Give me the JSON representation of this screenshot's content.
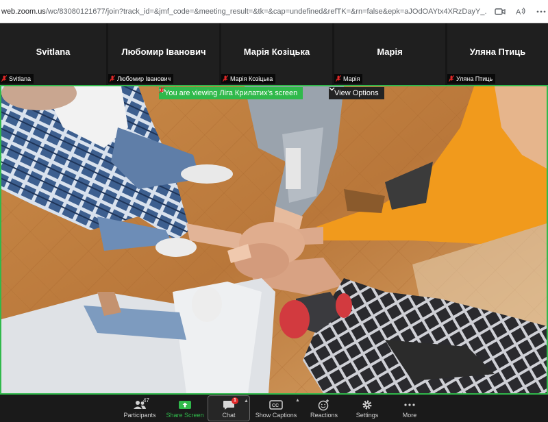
{
  "browser": {
    "url_host": "web.zoom.us",
    "url_path": "/wc/83080121677/join?track_id=&jmf_code=&meeting_result=&tk=&cap=undefined&refTK=&rn=false&epk=aJOdOAYtx4XRzDayY_..."
  },
  "participants": [
    {
      "name": "Svitlana",
      "label": "Svitlana"
    },
    {
      "name": "Любомир Іванович",
      "label": "Любомир Іванович"
    },
    {
      "name": "Марія Козіцька",
      "label": "Марія Козіцька"
    },
    {
      "name": "Марія",
      "label": "Марія"
    },
    {
      "name": "Уляна Птиць",
      "label": "Уляна Птиць"
    }
  ],
  "share": {
    "viewing_text": "You are viewing Ліга Крилатих's screen",
    "view_options": "View Options"
  },
  "toolbar": {
    "participants": {
      "label": "Participants",
      "count": "47"
    },
    "share_screen": {
      "label": "Share Screen"
    },
    "chat": {
      "label": "Chat",
      "badge": "1"
    },
    "captions": {
      "label": "Show Captions"
    },
    "reactions": {
      "label": "Reactions"
    },
    "settings": {
      "label": "Settings"
    },
    "more": {
      "label": "More"
    }
  },
  "colors": {
    "accent_green": "#30b94b",
    "muted_red": "#e02828",
    "toolbar_bg": "#1a1a1a"
  }
}
